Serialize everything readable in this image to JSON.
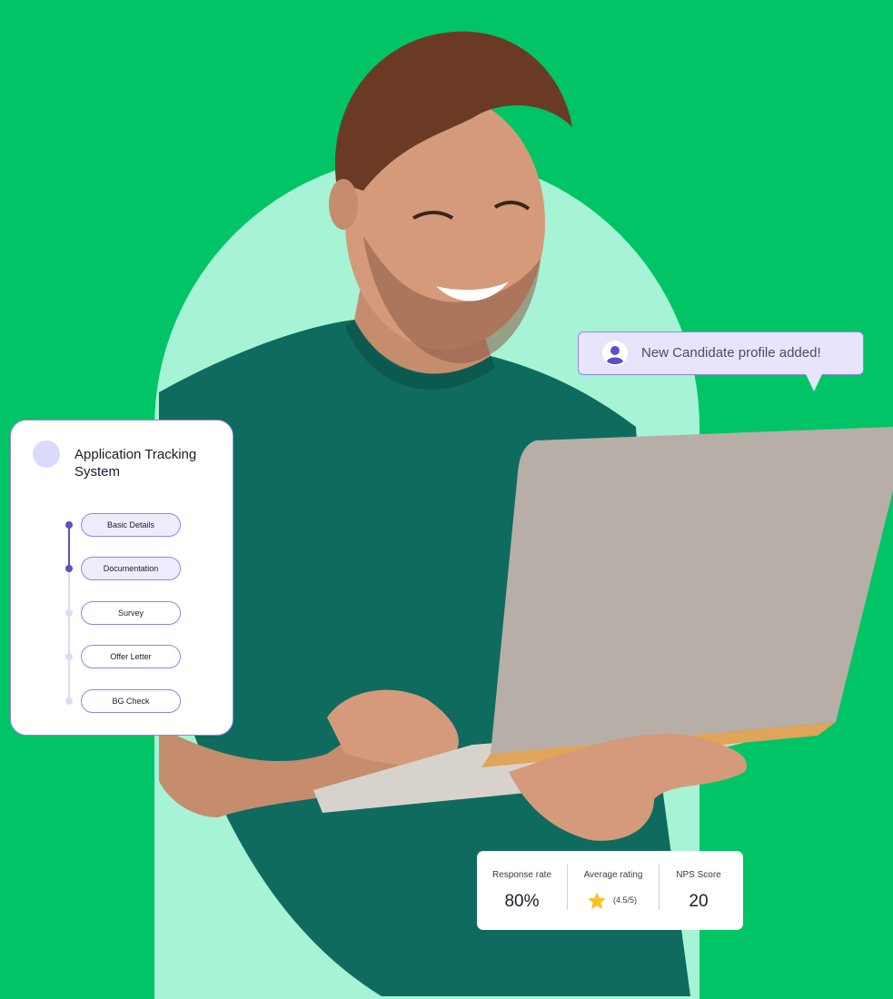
{
  "ats_card": {
    "title": "Application Tracking System",
    "steps": [
      {
        "label": "Basic Details",
        "status": "done"
      },
      {
        "label": "Documentation",
        "status": "done"
      },
      {
        "label": "Survey",
        "status": "todo"
      },
      {
        "label": "Offer Letter",
        "status": "todo"
      },
      {
        "label": "BG Check",
        "status": "todo"
      }
    ]
  },
  "notification": {
    "text": "New Candidate profile added!",
    "icon": "user-profile-icon"
  },
  "stats": {
    "response_rate": {
      "label": "Response rate",
      "value": "80%"
    },
    "average_rating": {
      "label": "Average rating",
      "value": "(4.5/5)",
      "icon": "star-icon"
    },
    "nps_score": {
      "label": "NPS Score",
      "value": "20"
    }
  },
  "colors": {
    "background": "#00c465",
    "oval": "#a6f3d5",
    "accent": "#5a50c8",
    "accent_border": "#8f85ec",
    "shirt": "#0f6b5e",
    "laptop": "#b7aea8"
  }
}
